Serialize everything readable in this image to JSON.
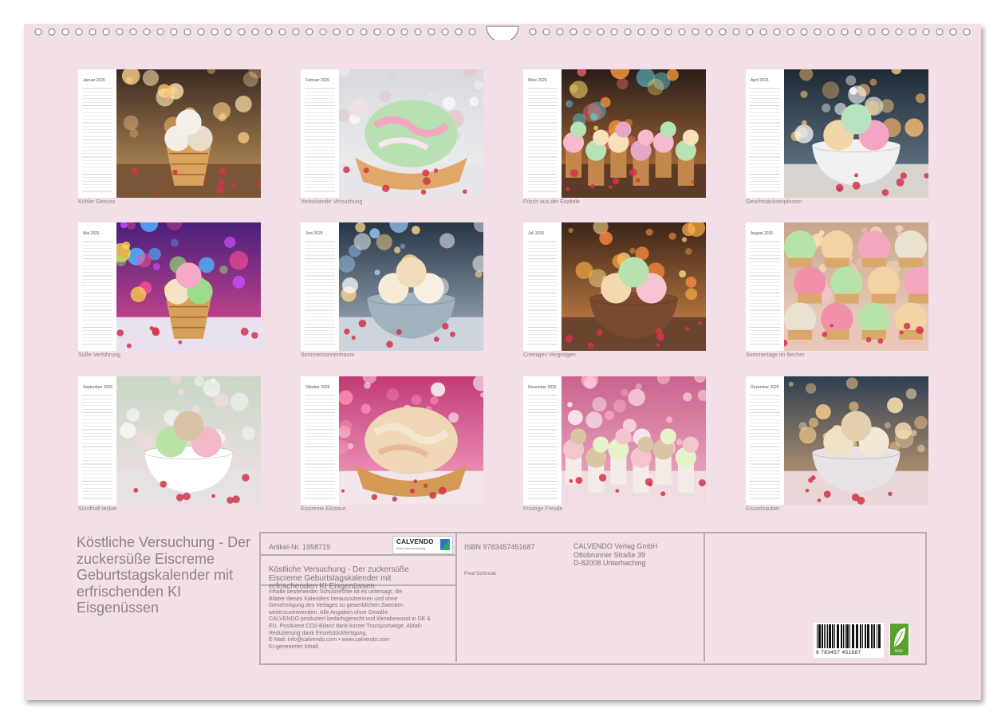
{
  "calendar": {
    "title": "Köstliche Versuchung - Der zuckersüße Eiscreme Geburtstagskalender mit erfrischenden KI Eisgenüssen",
    "months": [
      {
        "month": "Januar",
        "caption": "Kühler Genuss"
      },
      {
        "month": "Februar",
        "caption": "Verlockende Versuchung"
      },
      {
        "month": "März",
        "caption": "Frisch aus der Eisdiele"
      },
      {
        "month": "April",
        "caption": "Geschmacksexplosion"
      },
      {
        "month": "Mai",
        "caption": "Süße Verführung"
      },
      {
        "month": "Juni",
        "caption": "Sommersonnentraum"
      },
      {
        "month": "Juli",
        "caption": "Cremiges Vergnügen"
      },
      {
        "month": "August",
        "caption": "Sommertage im Becher"
      },
      {
        "month": "September",
        "caption": "Sündhaft lecker"
      },
      {
        "month": "Oktober",
        "caption": "Eiscreme-Ekstase"
      },
      {
        "month": "November",
        "caption": "Frostige Freude"
      },
      {
        "month": "Dezember",
        "caption": "Eiszeitzauber"
      }
    ],
    "year": "2026"
  },
  "info": {
    "article": "Artikel-Nr. 1958719",
    "logo_name": "CALVENDO",
    "logo_sub": "Kein Kalenderverlag",
    "isbn": "ISBN 9783457451687",
    "publisher_lines": [
      "CALVENDO Verlag GmbH",
      "Ottobrunner Straße 39",
      "D-82008 Unterhaching"
    ],
    "author": "Fred Schimak",
    "product_title_lines": [
      "Köstliche Versuchung - Der zuckersüße",
      "Eiscreme Geburtstagskalender mit",
      "erfrischenden KI Eisgenüssen"
    ],
    "legal_lines": [
      "Inhalte bestehender Schutzrechte ist es untersagt, die",
      "Blätter dieses Kalenders herauszutrennen und ohne",
      "Genehmigung des Verlages zu gewerblichen Zwecken",
      "weiterzuverwenden. Alle Angaben ohne Gewähr.",
      "CALVENDO produziert bedarfsgerecht und klimabewusst in DE &",
      "EU. Positivere CO2-Bilanz dank kurzer Transportwege. Abfall-",
      "Reduzierung dank Einzelstückfertigung.",
      "E-Mail: info@calvendo.com • www.calvendo.com",
      "KI-generierter Inhalt"
    ],
    "barcode_digits": "9 783457 451687",
    "eco_label": "eco"
  },
  "colors": {
    "sheet": "#f2dfe8",
    "text": "#8d8389",
    "border": "#b7adb3"
  }
}
